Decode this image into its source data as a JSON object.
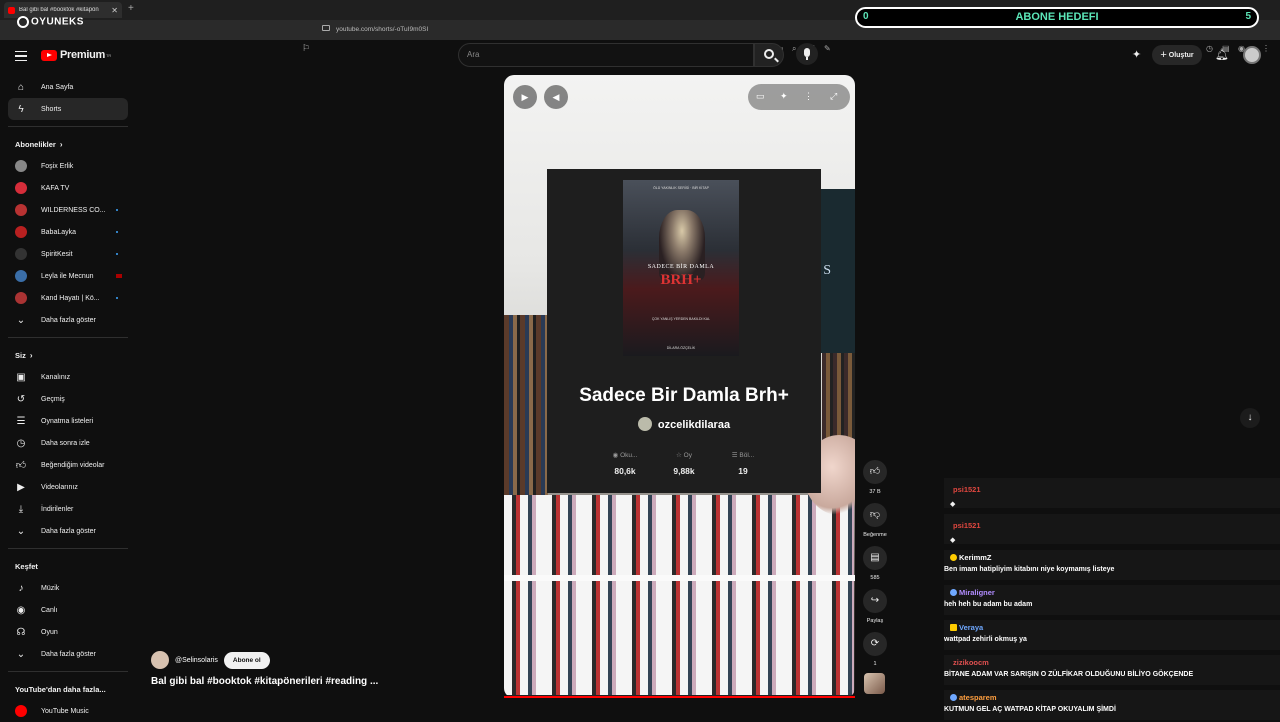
{
  "browser": {
    "tab_title": "Bal gibi bal #booktok #kitapön",
    "url": "youtube.com/shorts/-oTuI9m0SI",
    "overlay_logo": "OYUNEKS",
    "goal": {
      "current": "0",
      "label": "ABONE HEDEFI",
      "target": "5"
    }
  },
  "header": {
    "logo_text": "Premium",
    "logo_sup": "TR",
    "search_placeholder": "Ara",
    "create_label": "Oluştur"
  },
  "sidebar": {
    "main": [
      {
        "label": "Ana Sayfa",
        "icon": "home-icon"
      },
      {
        "label": "Shorts",
        "icon": "shorts-icon"
      }
    ],
    "subs_title": "Abonelikler",
    "subscriptions": [
      {
        "label": "Foşix Erlik",
        "color": "#888888"
      },
      {
        "label": "KAFA TV",
        "color": "#d62d3a"
      },
      {
        "label": "WILDERNESS CO...",
        "color": "#b83232"
      },
      {
        "label": "BabaLayka",
        "color": "#b82020"
      },
      {
        "label": "SpiritKesit",
        "color": "#333333"
      },
      {
        "label": "Leyla ile Mecnun",
        "color": "#3a6ea8"
      },
      {
        "label": "Kand Hayatı | Kö...",
        "color": "#a33"
      }
    ],
    "subs_more": "Daha fazla göster",
    "you_title": "Siz",
    "you": [
      {
        "label": "Kanalınız",
        "icon": "channel-icon"
      },
      {
        "label": "Geçmiş",
        "icon": "history-icon"
      },
      {
        "label": "Oynatma listeleri",
        "icon": "playlists-icon"
      },
      {
        "label": "Daha sonra izle",
        "icon": "watch-later-icon"
      },
      {
        "label": "Beğendiğim videolar",
        "icon": "liked-icon"
      },
      {
        "label": "Videolarınız",
        "icon": "your-videos-icon"
      },
      {
        "label": "İndirilenler",
        "icon": "downloads-icon"
      },
      {
        "label": "Daha fazla göster",
        "icon": "chevron-down-icon"
      }
    ],
    "explore_title": "Keşfet",
    "explore": [
      {
        "label": "Müzik",
        "icon": "music-icon"
      },
      {
        "label": "Canlı",
        "icon": "live-icon"
      },
      {
        "label": "Oyun",
        "icon": "gaming-icon"
      },
      {
        "label": "Daha fazla göster",
        "icon": "chevron-down-icon"
      }
    ],
    "more_title": "YouTube'dan daha fazla...",
    "more": [
      {
        "label": "YouTube Music",
        "icon": "youtube-music-icon"
      }
    ]
  },
  "short": {
    "book_title": "Sadece Bir Damla Brh+",
    "book_author": "ozcelikdilaraa",
    "cover_top": "ÖLÜ YAKINLIK SERİSİ · BİR KİTAP",
    "cover_title": "SADECE BİR DAMLA",
    "cover_big": "BRH+",
    "cover_quote": "ÇOK YANLIŞ YERDEN BAKILDI KAL",
    "cover_author": "DİLARA ÖZÇELİK",
    "side_book_text": "TA S",
    "stats": [
      {
        "label": "Oku...",
        "value": "80,6k",
        "icon": "eye-icon"
      },
      {
        "label": "Oy",
        "value": "9,88k",
        "icon": "star-icon"
      },
      {
        "label": "Böl...",
        "value": "19",
        "icon": "list-icon"
      }
    ],
    "channel": "@Selinsolaris",
    "subscribe_label": "Abone ol",
    "video_title": "Bal gibi bal #booktok #kitapönerileri #reading ..."
  },
  "actions": [
    {
      "label": "37 B",
      "icon": "like-icon",
      "glyph": "👍"
    },
    {
      "label": "Beğenme",
      "icon": "dislike-icon",
      "glyph": "👎"
    },
    {
      "label": "585",
      "icon": "comment-icon",
      "glyph": "💬"
    },
    {
      "label": "Paylaş",
      "icon": "share-icon",
      "glyph": "↪"
    },
    {
      "label": "1",
      "icon": "remix-icon",
      "glyph": "⟳"
    }
  ],
  "chat": [
    {
      "user": "psi1521",
      "color": "#e0473f",
      "text": ""
    },
    {
      "user": "psi1521",
      "color": "#e0473f",
      "text": ""
    },
    {
      "user": "KerimmZ",
      "color": "#ffffff",
      "text": "Ben imam hatipliyim kitabını niye koymamış listeye"
    },
    {
      "user": "Miraligner",
      "color": "#b18cff",
      "text": "heh heh bu adam bu adam"
    },
    {
      "user": "Veraya",
      "color": "#6fa8ff",
      "text": "wattpad zehirli okmuş ya"
    },
    {
      "user": "zizikoocm",
      "color": "#e05050",
      "text": "BİTANE ADAM VAR SARIŞIN O ZÜLFİKAR OLDUĞUNU BİLİYO GÖKÇENDE"
    },
    {
      "user": "atesparem",
      "color": "#ff9f3f",
      "text": "KUTMUN GEL AÇ WATPAD KİTAP OKUYALIM ŞİMDİ"
    }
  ]
}
